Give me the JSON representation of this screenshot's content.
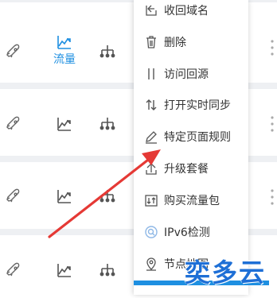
{
  "rows": [
    {
      "flow_label": "流量"
    }
  ],
  "context_menu": {
    "items": [
      {
        "label": "收回域名",
        "icon": "retrieve-icon"
      },
      {
        "label": "删除",
        "icon": "trash-icon"
      },
      {
        "label": "访问回源",
        "icon": "pause-bars-icon"
      },
      {
        "label": "打开实时同步",
        "icon": "sync-arrows-icon"
      },
      {
        "label": "特定页面规则",
        "icon": "pencil-icon"
      },
      {
        "label": "升级套餐",
        "icon": "upgrade-icon"
      },
      {
        "label": "购买流量包",
        "icon": "traffic-package-icon"
      },
      {
        "label": "IPv6检测",
        "icon": "ipv6-check-icon"
      },
      {
        "label": "节点地图",
        "icon": "map-pin-icon"
      }
    ]
  },
  "watermark": {
    "text": "奕多云"
  },
  "colors": {
    "accent": "#1e8fe1",
    "separator": "#eef0f3",
    "annotation_arrow": "#e53935",
    "icon_gray": "#666666"
  }
}
